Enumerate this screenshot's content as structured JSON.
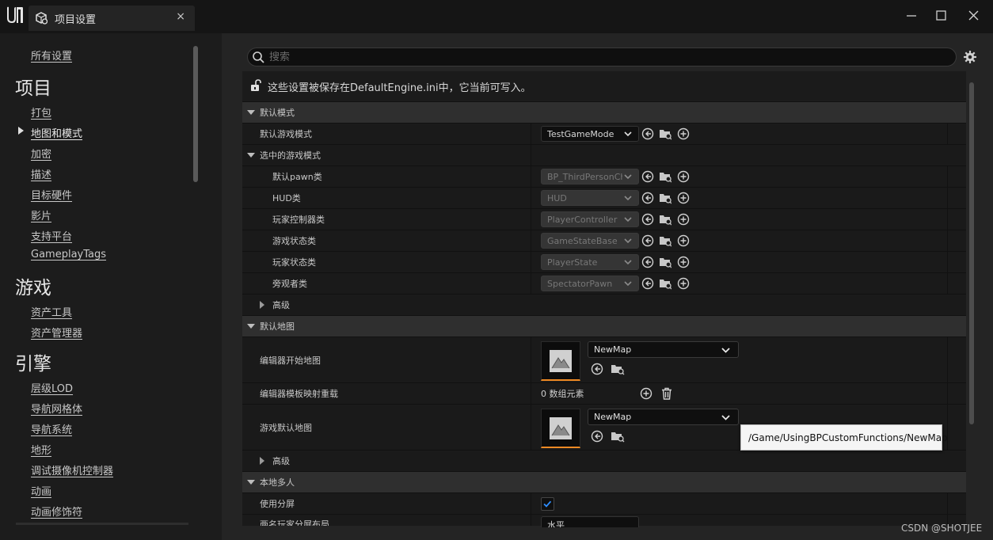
{
  "window": {
    "tab_title": "项目设置",
    "tab_close": "×",
    "tab_icon": "project-settings-cubes-icon",
    "logo_icon": "unreal-engine-logo-icon"
  },
  "sidebar": {
    "all_settings": "所有设置",
    "sections": [
      {
        "title": "项目",
        "items": [
          "打包",
          "地图和模式",
          "加密",
          "描述",
          "目标硬件",
          "影片",
          "支持平台",
          "GameplayTags"
        ]
      },
      {
        "title": "游戏",
        "items": [
          "资产工具",
          "资产管理器"
        ]
      },
      {
        "title": "引擎",
        "items": [
          "层级LOD",
          "导航网格体",
          "导航系统",
          "地形",
          "调试摄像机控制器",
          "动画",
          "动画修饰符"
        ]
      }
    ],
    "active_item": "地图和模式"
  },
  "search": {
    "placeholder": "搜索"
  },
  "notice": {
    "text": "这些设置被保存在DefaultEngine.ini中，它当前可写入。"
  },
  "sections": {
    "default_modes": "默认模式",
    "selected_game_mode": "选中的游戏模式",
    "default_maps": "默认地图",
    "local_multiplayer": "本地多人"
  },
  "properties": {
    "default_game_mode": {
      "label": "默认游戏模式",
      "value": "TestGameMode"
    },
    "selected": [
      {
        "label": "默认pawn类",
        "value": "BP_ThirdPersonCharacter"
      },
      {
        "label": "HUD类",
        "value": "HUD"
      },
      {
        "label": "玩家控制器类",
        "value": "PlayerController"
      },
      {
        "label": "游戏状态类",
        "value": "GameStateBase"
      },
      {
        "label": "玩家状态类",
        "value": "PlayerState"
      },
      {
        "label": "旁观者类",
        "value": "SpectatorPawn"
      }
    ],
    "advanced": "高级",
    "editor_startup_map": {
      "label": "编辑器开始地图",
      "value": "NewMap"
    },
    "editor_template_map_overrides": {
      "label": "编辑器模板映射重载",
      "value": "0 数组元素"
    },
    "game_default_map": {
      "label": "游戏默认地图",
      "value": "NewMap"
    },
    "use_splitscreen": {
      "label": "使用分屏",
      "checked": true
    },
    "two_player_splitscreen_layout": {
      "label": "两名玩家分屏布局",
      "value": "水平"
    }
  },
  "tooltip": {
    "text": "/Game/UsingBPCustomFunctions/NewMap"
  },
  "watermark": "CSDN @SHOTJEE",
  "colors": {
    "background": "#151515",
    "sidebar": "#1c1c1c",
    "panel": "#242424",
    "section_header": "#2f2f2f",
    "row": "#1a1a1a",
    "thumbnail_accent": "#f08a24",
    "checkbox_check": "#2f8fff"
  }
}
